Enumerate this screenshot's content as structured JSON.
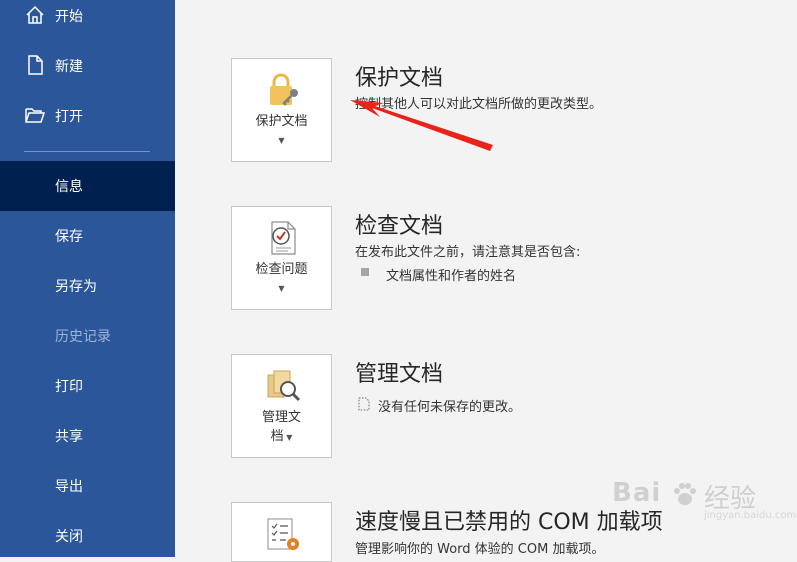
{
  "sidebar": {
    "items": [
      {
        "label": "开始",
        "icon": "home-icon"
      },
      {
        "label": "新建",
        "icon": "new-document-icon"
      },
      {
        "label": "打开",
        "icon": "open-folder-icon"
      },
      {
        "label": "信息",
        "selected": true
      },
      {
        "label": "保存"
      },
      {
        "label": "另存为"
      },
      {
        "label": "历史记录",
        "disabled": true
      },
      {
        "label": "打印"
      },
      {
        "label": "共享"
      },
      {
        "label": "导出"
      },
      {
        "label": "关闭"
      }
    ]
  },
  "sections": [
    {
      "button_label": "保护文档",
      "icon": "lock-key-icon",
      "title": "保护文档",
      "description": "控制其他人可以对此文档所做的更改类型。"
    },
    {
      "button_label": "检查问题",
      "icon": "inspect-document-icon",
      "title": "检查文档",
      "description": "在发布此文件之前，请注意其是否包含:",
      "bullets": [
        "文档属性和作者的姓名"
      ]
    },
    {
      "button_label_line1": "管理文",
      "button_label_line2": "档",
      "icon": "manage-document-icon",
      "title": "管理文档",
      "description": "没有任何未保存的更改。"
    },
    {
      "icon": "com-addins-icon",
      "title": "速度慢且已禁用的 COM 加载项",
      "description": "管理影响你的 Word 体验的 COM 加载项。"
    }
  ],
  "colors": {
    "sidebar": "#2b579a",
    "sidebar_selected": "#002050",
    "annotation_arrow": "#e8241a"
  },
  "watermark": {
    "brand": "Bai",
    "name": "经验",
    "url": "jingyan.baidu.com"
  }
}
